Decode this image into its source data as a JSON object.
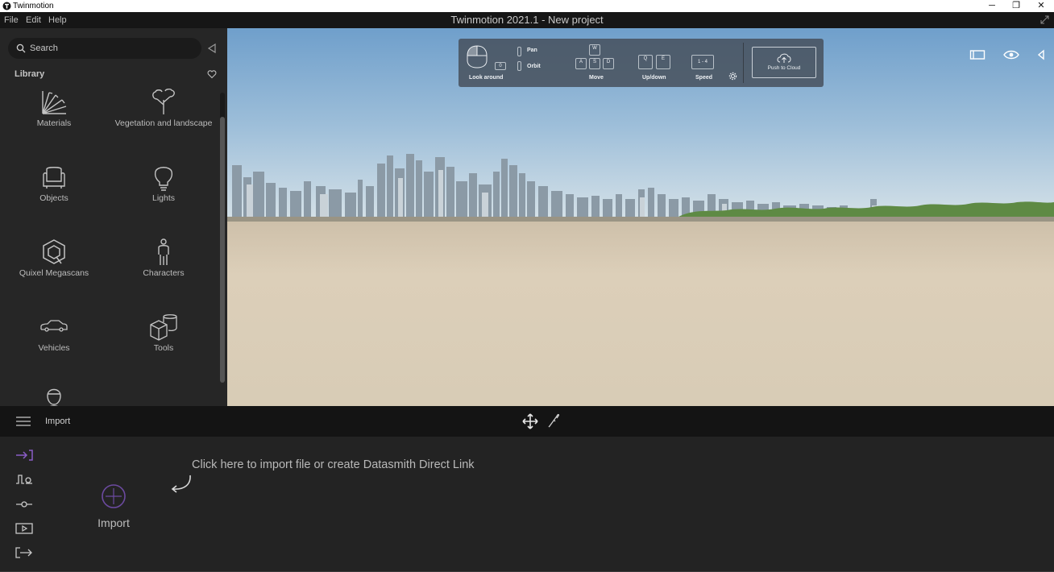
{
  "os_window": {
    "app_name": "Twinmotion",
    "controls": {
      "minimize": "─",
      "restore": "❐",
      "close": "✕"
    }
  },
  "menu": {
    "items": [
      "File",
      "Edit",
      "Help"
    ],
    "title": "Twinmotion 2021.1 - New project"
  },
  "library": {
    "search_placeholder": "Search",
    "title": "Library",
    "items": [
      {
        "label": "Materials",
        "icon": "materials-icon"
      },
      {
        "label": "Vegetation and landscape",
        "icon": "tree-icon"
      },
      {
        "label": "Objects",
        "icon": "sofa-icon"
      },
      {
        "label": "Lights",
        "icon": "bulb-icon"
      },
      {
        "label": "Quixel Megascans",
        "icon": "quixel-icon"
      },
      {
        "label": "Characters",
        "icon": "person-icon"
      },
      {
        "label": "Vehicles",
        "icon": "car-icon"
      },
      {
        "label": "Tools",
        "icon": "cubes-icon"
      },
      {
        "label": "",
        "icon": "bust-icon"
      }
    ]
  },
  "navigation_help": {
    "look_around": "Look around",
    "pan": "Pan",
    "orbit": "Orbit",
    "orbit_key": "0",
    "move": "Move",
    "move_keys": {
      "w": "W",
      "a": "A",
      "s": "S",
      "d": "D"
    },
    "up_down": "Up/down",
    "up_keys": {
      "q": "Q",
      "e": "E"
    },
    "speed": "Speed",
    "speed_keys": "1 - 4",
    "push_to_cloud": "Push to Cloud"
  },
  "bottom_bar": {
    "title": "Import"
  },
  "import_panel": {
    "hint": "Click here to import file or create Datasmith Direct Link",
    "import_label": "Import",
    "sidebar_icons": [
      "import-icon",
      "context-icon",
      "settings-slider-icon",
      "media-icon",
      "export-icon"
    ]
  },
  "colors": {
    "accent": "#8a5cc8",
    "panel_bg": "#262626",
    "bottom_bg": "#232323"
  }
}
